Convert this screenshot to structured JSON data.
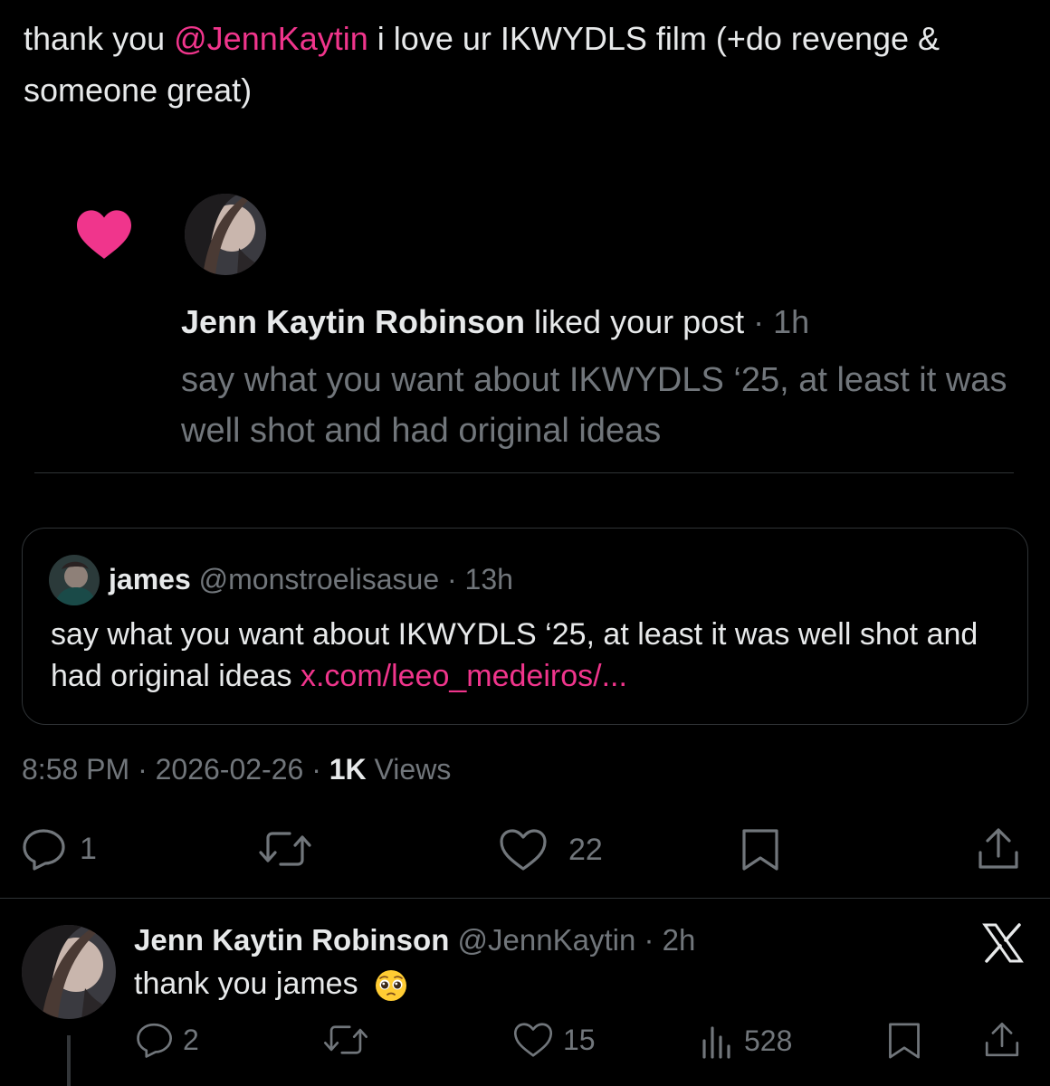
{
  "tweet": {
    "text_before": "thank you ",
    "mention": "@JennKaytin",
    "text_after": " i love ur IKWYDLS film (+do revenge & someone great)"
  },
  "notification": {
    "icon": "heart-icon",
    "name": "Jenn Kaytin Robinson",
    "action": " liked your post",
    "sep": " · ",
    "time": "1h",
    "body": "say what you want about IKWYDLS ‘25, at least it was well shot and had original ideas"
  },
  "quote": {
    "name": "james",
    "handle": "@monstroelisasue",
    "sep": " · ",
    "time": "13h",
    "body": "say what you want about IKWYDLS ‘25, at least it was well shot and had original ideas ",
    "link": "x.com/leeo_medeiros/..."
  },
  "meta": {
    "time": "8:58 PM",
    "sep": " · ",
    "date": "2026-02-26",
    "views_count": "1K",
    "views_label": " Views"
  },
  "actions": {
    "replies": "1",
    "reposts": "",
    "likes": "22"
  },
  "reply": {
    "name": "Jenn Kaytin Robinson",
    "handle": "@JennKaytin",
    "sep": " · ",
    "time": "2h",
    "text": "thank you james",
    "emoji": "pleading-face-emoji",
    "replies": "2",
    "likes": "15",
    "views": "528"
  },
  "colors": {
    "background": "#000000",
    "accent": "#f0358c",
    "text": "#e7e9ea",
    "muted": "#71767b",
    "border": "#2f3336"
  }
}
